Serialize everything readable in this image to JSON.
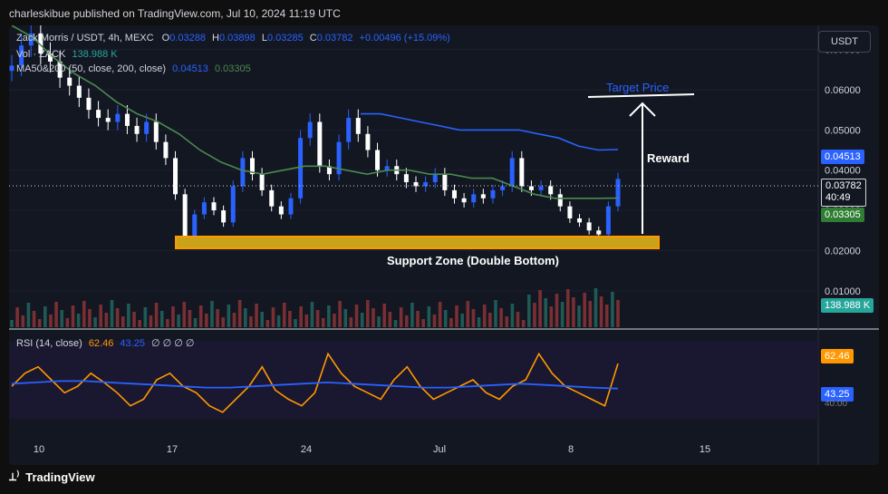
{
  "header": {
    "publisher_line": "charleskibue published on TradingView.com, Jul 10, 2024 11:19 UTC"
  },
  "legend": {
    "symbol": "Zack Morris / USDT, 4h, MEXC",
    "open_label": "O",
    "open": "0.03288",
    "high_label": "H",
    "high": "0.03898",
    "low_label": "L",
    "low": "0.03285",
    "close_label": "C",
    "close": "0.03782",
    "change": "+0.00496 (+15.09%)",
    "vol_label": "Vol · ZACK",
    "vol_value": "138.988 K",
    "ma_label": "MA50&200 (50, close, 200, close)",
    "ma50_value": "0.04513",
    "ma200_value": "0.03305",
    "rsi_label": "RSI (14, close)",
    "rsi_value": "62.46",
    "rsi_ma_value": "43.25",
    "rsi_extra": "∅ ∅ ∅ ∅"
  },
  "currency_button": "USDT",
  "price_axis": {
    "ticks": [
      "0.07000",
      "0.06000",
      "0.05000",
      "0.04000",
      "0.03000",
      "0.02000",
      "0.01000"
    ]
  },
  "tags": {
    "ma200_tag": "0.04513",
    "price_tag": "0.03782",
    "countdown": "40:49",
    "ma50_tag": "0.03305",
    "volume_tag": "138.988 K",
    "rsi_tag": "62.46",
    "rsi_ma_tag": "43.25",
    "rsi_axis_partial": "40.00"
  },
  "time_axis": {
    "ticks": [
      "10",
      "17",
      "24",
      "Jul",
      "8",
      "15"
    ]
  },
  "annotations": {
    "target_price": "Target Price",
    "reward": "Reward",
    "support_zone": "Support Zone (Double Bottom)"
  },
  "footer": {
    "brand": "TradingView"
  },
  "colors": {
    "up": "#2962ff",
    "down": "#ffffff",
    "ma50": "#4a8a4f",
    "ma200": "#2962ff",
    "rsi": "#ff9800",
    "rsi_ma": "#2962ff",
    "support_fill": "#c9a21a",
    "support_border": "#ff9800"
  },
  "chart_data": {
    "type": "line",
    "title": "Zack Morris / USDT, 4h, MEXC",
    "y_axis_range": [
      0.005,
      0.076
    ],
    "x_ticks": [
      "10",
      "17",
      "24",
      "Jul",
      "8",
      "15"
    ],
    "price_series": {
      "name": "Close (approx)",
      "values": [
        0.066,
        0.071,
        0.074,
        0.069,
        0.067,
        0.063,
        0.061,
        0.058,
        0.055,
        0.053,
        0.052,
        0.054,
        0.051,
        0.049,
        0.052,
        0.047,
        0.043,
        0.034,
        0.023,
        0.029,
        0.032,
        0.03,
        0.027,
        0.036,
        0.043,
        0.039,
        0.035,
        0.031,
        0.029,
        0.033,
        0.048,
        0.052,
        0.041,
        0.039,
        0.047,
        0.053,
        0.049,
        0.045,
        0.04,
        0.041,
        0.039,
        0.037,
        0.036,
        0.037,
        0.039,
        0.035,
        0.033,
        0.032,
        0.034,
        0.033,
        0.035,
        0.036,
        0.043,
        0.036,
        0.035,
        0.036,
        0.034,
        0.031,
        0.028,
        0.027,
        0.025,
        0.024,
        0.031,
        0.03782
      ]
    },
    "ma50_series": {
      "name": "MA50",
      "values": [
        0.076,
        0.073,
        0.068,
        0.064,
        0.061,
        0.057,
        0.054,
        0.052,
        0.049,
        0.045,
        0.042,
        0.04,
        0.039,
        0.04,
        0.041,
        0.041,
        0.04,
        0.039,
        0.04,
        0.04,
        0.039,
        0.039,
        0.038,
        0.038,
        0.036,
        0.034,
        0.033,
        0.033,
        0.033,
        0.03305
      ]
    },
    "ma200_series": {
      "name": "MA200",
      "values": [
        0.054,
        0.054,
        0.053,
        0.052,
        0.051,
        0.05,
        0.05,
        0.05,
        0.05,
        0.049,
        0.048,
        0.046,
        0.045,
        0.04513
      ]
    },
    "rsi_series": {
      "name": "RSI (14, close)",
      "values": [
        45,
        55,
        60,
        50,
        40,
        45,
        55,
        48,
        40,
        30,
        35,
        50,
        55,
        45,
        40,
        30,
        25,
        35,
        45,
        60,
        42,
        35,
        30,
        40,
        70,
        55,
        45,
        40,
        35,
        50,
        60,
        45,
        35,
        40,
        45,
        50,
        40,
        35,
        45,
        50,
        70,
        55,
        45,
        40,
        35,
        30,
        62.46
      ]
    },
    "rsi_ma_series": {
      "name": "RSI MA",
      "values": [
        47,
        48,
        49,
        49,
        48,
        47,
        46,
        45,
        44,
        44,
        45,
        46,
        47,
        48,
        47,
        46,
        45,
        44,
        44,
        45,
        46,
        47,
        46,
        45,
        44,
        43.25
      ]
    },
    "support_zone": [
      0.0215,
      0.0245
    ],
    "target_price": 0.06
  }
}
